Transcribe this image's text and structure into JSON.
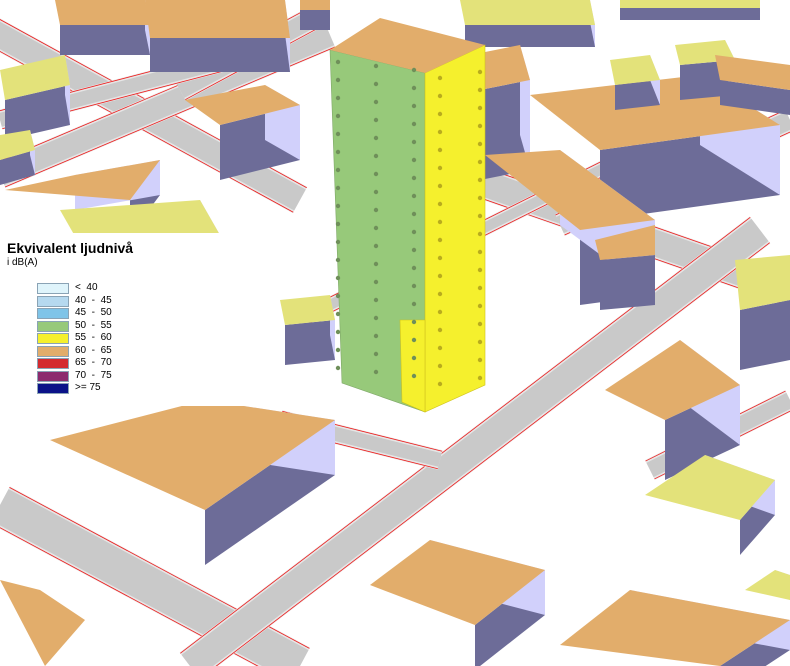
{
  "legend": {
    "title": "Ekvivalent ljudnivå",
    "unit": "i dB(A)",
    "classes": [
      {
        "label": "<  40",
        "color": "#dff4fb"
      },
      {
        "label": "40  -  45",
        "color": "#b6d9ef"
      },
      {
        "label": "45  -  50",
        "color": "#7fc4e8"
      },
      {
        "label": "50  -  55",
        "color": "#97c97a"
      },
      {
        "label": "55  -  60",
        "color": "#f5f02d"
      },
      {
        "label": "60  -  65",
        "color": "#e2ad6b"
      },
      {
        "label": "65  -  70",
        "color": "#d42a2f"
      },
      {
        "label": "70  -  75",
        "color": "#8c2a6e"
      },
      {
        "label": ">= 75",
        "color": "#0a1288"
      }
    ]
  },
  "colors": {
    "roof": "#e2ad6b",
    "roof_loud": "#e3e27a",
    "wall_dark": "#6d6c98",
    "wall_light": "#d1d0fb",
    "road": "#c9c9c9",
    "road_edge": "#e6e6e6",
    "road_line": "#ee1d1d",
    "tower_green": "#97c97a",
    "tower_yellow": "#f5f02d"
  }
}
